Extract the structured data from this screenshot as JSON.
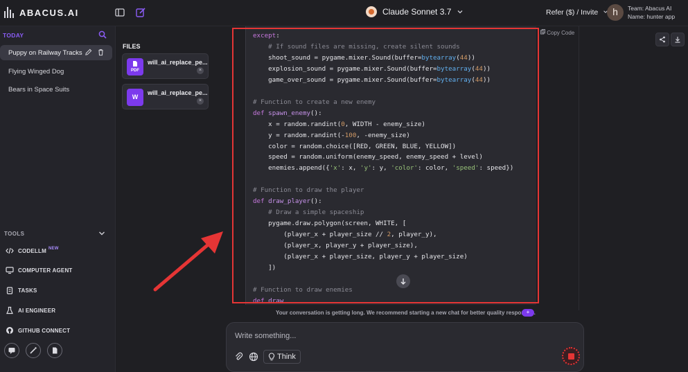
{
  "app": {
    "logo_text": "ABACUS.AI"
  },
  "header": {
    "model_name": "Claude Sonnet 3.7",
    "refer_label": "Refer ($) / Invite",
    "avatar_letter": "h",
    "team_line": "Team: Abacus AI",
    "name_line": "Name: hunter app"
  },
  "sidebar": {
    "section_today": "TODAY",
    "chats": [
      "Puppy on Railway Tracks",
      "Flying Winged Dog",
      "Bears in Space Suits"
    ],
    "tools_label": "TOOLS",
    "tools": [
      "CODELLM",
      "COMPUTER AGENT",
      "TASKS",
      "AI ENGINEER",
      "GITHUB CONNECT"
    ],
    "new_badge": "NEW"
  },
  "files": {
    "title": "FILES",
    "items": [
      {
        "name": "will_ai_replace_pe...",
        "type": "PDF"
      },
      {
        "name": "will_ai_replace_pe...",
        "type": "W"
      }
    ]
  },
  "code": {
    "copy_label": "Copy Code",
    "lines": [
      "except:",
      "    # If sound files are missing, create silent sounds",
      "    shoot_sound = pygame.mixer.Sound(buffer=bytearray(44))",
      "    explosion_sound = pygame.mixer.Sound(buffer=bytearray(44))",
      "    game_over_sound = pygame.mixer.Sound(buffer=bytearray(44))",
      "",
      "# Function to create a new enemy",
      "def spawn_enemy():",
      "    x = random.randint(0, WIDTH - enemy_size)",
      "    y = random.randint(-100, -enemy_size)",
      "    color = random.choice([RED, GREEN, BLUE, YELLOW])",
      "    speed = random.uniform(enemy_speed, enemy_speed + level)",
      "    enemies.append({'x': x, 'y': y, 'color': color, 'speed': speed})",
      "",
      "# Function to draw the player",
      "def draw_player():",
      "    # Draw a simple spaceship",
      "    pygame.draw.polygon(screen, WHITE, [",
      "        (player_x + player_size // 2, player_y),",
      "        (player_x, player_y + player_size),",
      "        (player_x + player_size, player_y + player_size)",
      "    ])",
      "",
      "# Function to draw enemies",
      "def draw"
    ]
  },
  "chat": {
    "notice": "Your conversation is getting long. We recommend starting a new chat for better quality responses.",
    "notice_badge": "+",
    "input_placeholder": "Write something...",
    "think_label": "Think"
  },
  "colors": {
    "accent": "#7c3aed",
    "annotation_red": "#e53535"
  }
}
